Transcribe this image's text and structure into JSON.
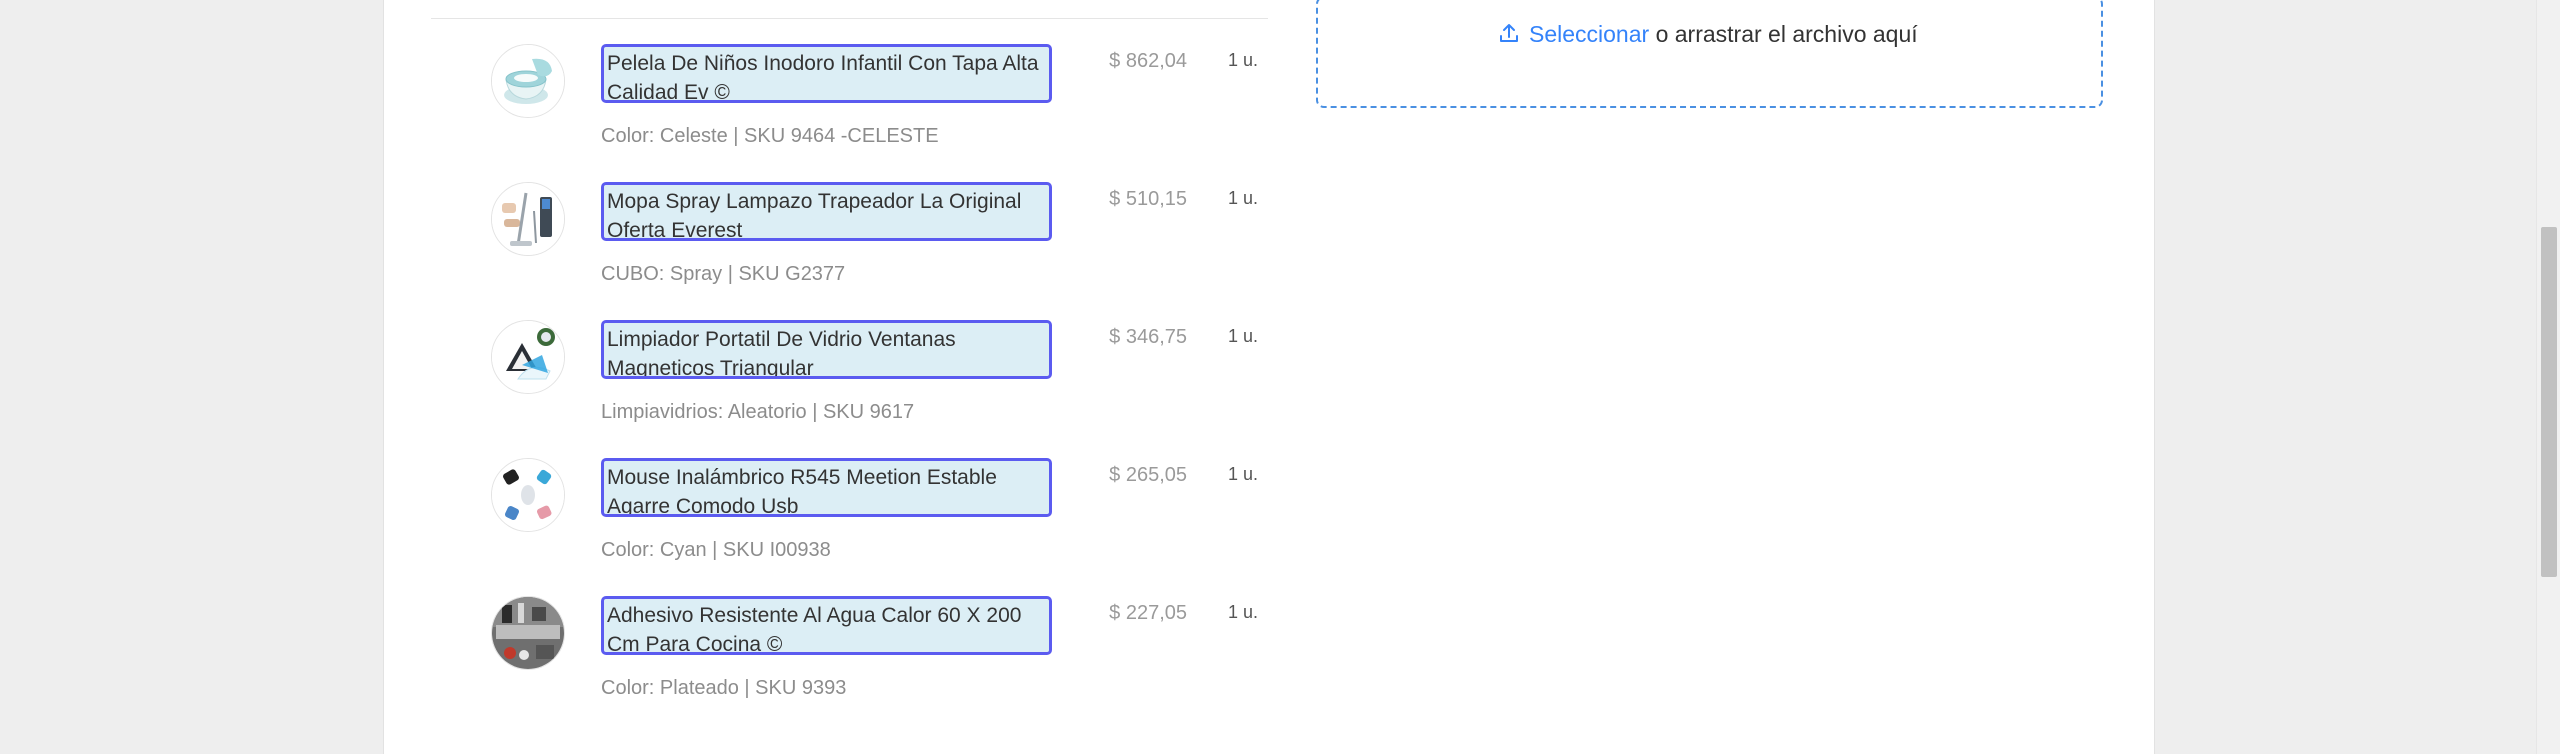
{
  "items": [
    {
      "title": "Pelela De Niños Inodoro Infantil Con Tapa Alta Calidad Ev ©",
      "meta": "Color: Celeste | SKU 9464 -CELESTE",
      "price": "$ 862,04",
      "qty": "1 u.",
      "thumb_icon": "potty-image"
    },
    {
      "title": "Mopa Spray Lampazo Trapeador La Original Oferta Everest",
      "meta": "CUBO: Spray | SKU G2377",
      "price": "$ 510,15",
      "qty": "1 u.",
      "thumb_icon": "mop-image"
    },
    {
      "title": "Limpiador Portatil De Vidrio Ventanas Magneticos Triangular",
      "meta": "Limpiavidrios: Aleatorio | SKU 9617",
      "price": "$ 346,75",
      "qty": "1 u.",
      "thumb_icon": "window-cleaner-image"
    },
    {
      "title": "Mouse Inalámbrico R545 Meetion Estable Agarre Comodo Usb",
      "meta": "Color: Cyan | SKU I00938",
      "price": "$ 265,05",
      "qty": "1 u.",
      "thumb_icon": "mouse-image"
    },
    {
      "title": "Adhesivo Resistente Al Agua Calor 60 X 200 Cm Para Cocina ©",
      "meta": "Color: Plateado | SKU 9393",
      "price": "$ 227,05",
      "qty": "1 u.",
      "thumb_icon": "kitchen-sticker-image"
    }
  ],
  "upload": {
    "link_text": "Seleccionar",
    "rest_text": "o arrastrar el archivo aquí",
    "icon": "upload-icon"
  },
  "colors": {
    "accent_blue": "#3483fa",
    "dashed_border": "#4a90e2",
    "title_highlight_bg": "#dceef5",
    "title_highlight_border": "#5b5bf0"
  }
}
